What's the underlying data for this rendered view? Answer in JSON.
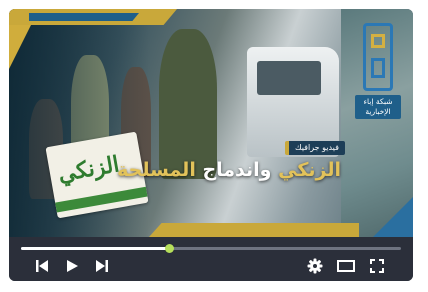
{
  "video": {
    "tag": "فيديو جرافيك",
    "headline_part1": "الزنكي",
    "headline_part2": "واندماج",
    "headline_part3": "المسلحة",
    "flag_text": "الزنكي",
    "channel_logo_text": "شبكة إباء الإخبارية"
  },
  "player": {
    "progress": 0.39,
    "accent_color": "#b6df5b"
  },
  "controls": {
    "prev_icon": "skip-previous-icon",
    "play_icon": "play-icon",
    "next_icon": "skip-next-icon",
    "settings_icon": "gear-icon",
    "theater_icon": "theater-mode-icon",
    "fullscreen_icon": "fullscreen-icon"
  }
}
